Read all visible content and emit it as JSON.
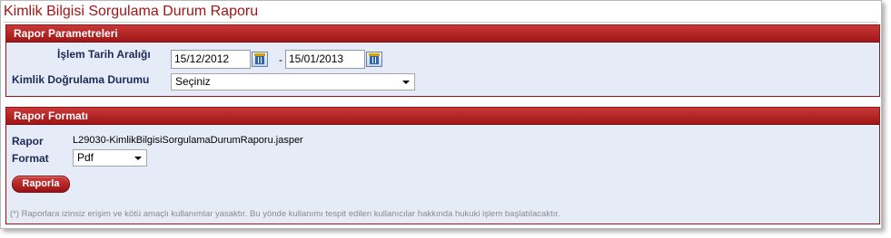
{
  "page_title": "Kimlik Bilgisi Sorgulama Durum Raporu",
  "params_panel": {
    "header": "Rapor Parametreleri",
    "date_range_label": "İşlem Tarih Aralığı",
    "start_date": "15/12/2012",
    "separator": "-",
    "end_date": "15/01/2013",
    "status_label": "Kimlik Doğrulama Durumu",
    "status_selected": "Seçiniz"
  },
  "format_panel": {
    "header": "Rapor Formatı",
    "report_label": "Rapor",
    "report_value": "L29030-KimlikBilgisiSorgulamaDurumRaporu.jasper",
    "format_label": "Format",
    "format_selected": "Pdf",
    "button_label": "Raporla",
    "notice": "(*) Raporlara izinsiz erişim ve kötü amaçlı kullanımlar yasaktır. Bu yönde kullanımı tespit edilen kullanıcılar hakkında hukuki işlem başlatılacaktır."
  },
  "colors": {
    "title": "#a31515",
    "header_bg": "#b02222",
    "panel_bg": "#e6ecf7",
    "label": "#1e2a56"
  }
}
